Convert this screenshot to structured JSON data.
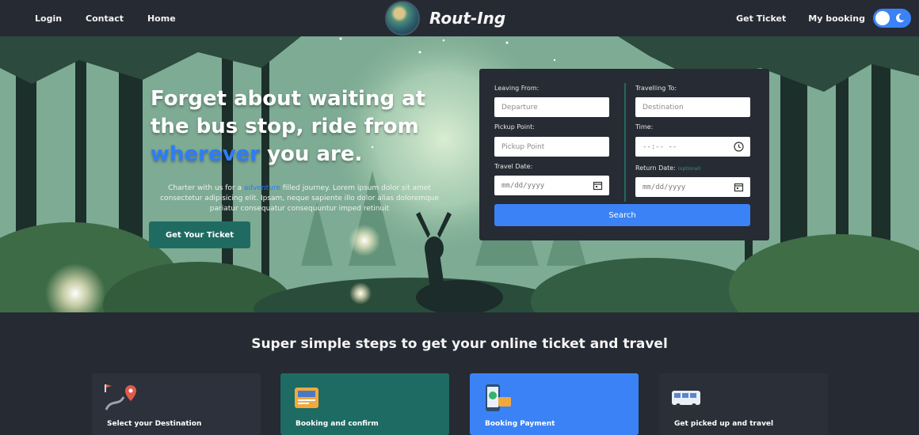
{
  "nav": {
    "left_links": [
      "Login",
      "Contact",
      "Home"
    ],
    "brand_name": "Rout-Ing",
    "get_ticket": "Get Ticket",
    "my_booking": "My booking"
  },
  "hero": {
    "headline_part1": "Forget about waiting at the bus stop, ride from",
    "headline_accent": "wherever",
    "headline_part2": "you are.",
    "blurb_part1": "Charter with us for a",
    "blurb_accent": "adventure",
    "blurb_part2": "filled journey. Lorem ipsum dolor sit amet consectetur adipisicing elit. Ipsam, neque sapiente illo dolor alias doloremque pariatur consequatur consequuntur imped retinuit",
    "cta_label": "Get Your Ticket"
  },
  "search": {
    "leaving_from_label": "Leaving From:",
    "leaving_from_placeholder": "Departure",
    "travelling_to_label": "Travelling To:",
    "travelling_to_placeholder": "Destination",
    "pickup_label": "Pickup Point:",
    "pickup_placeholder": "Pickup Point",
    "time_label": "Time:",
    "time_value": "--:-- --",
    "travel_date_label": "Travel Date:",
    "travel_date_value": "mm/dd/yyyy",
    "return_date_label": "Return Date:",
    "return_date_note": "(optional)",
    "return_date_value": "mm/dd/yyyy",
    "search_label": "Search"
  },
  "steps": {
    "title": "Super simple steps to get your online ticket and travel",
    "cards": [
      {
        "label": "Select your Destination",
        "icon": "map-pin-route-icon",
        "color": "#2c313b"
      },
      {
        "label": "Booking and confirm",
        "icon": "ticket-icon",
        "color": "#1d6b63"
      },
      {
        "label": "Booking Payment",
        "icon": "phone-payment-icon",
        "color": "#3b82f6"
      },
      {
        "label": "Get picked up and travel",
        "icon": "bus-icon",
        "color": "#2a2f38"
      }
    ]
  },
  "colors": {
    "accent_blue": "#3b82f6",
    "teal": "#1d6b63",
    "nav_bg": "#262a33"
  }
}
